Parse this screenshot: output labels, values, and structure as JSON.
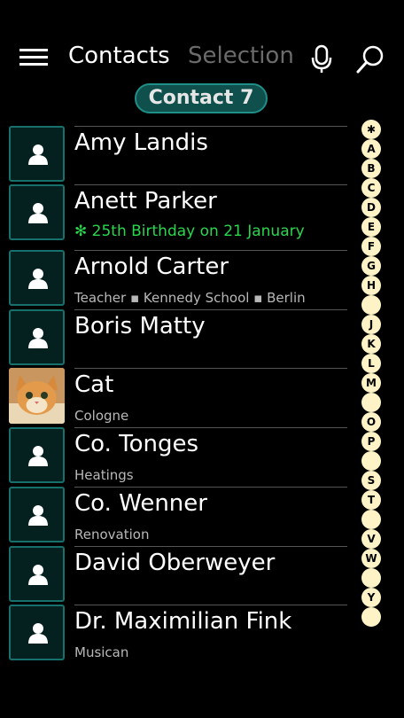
{
  "header": {
    "tab_contacts": "Contacts",
    "tab_selection": "Selection"
  },
  "contact_count": "Contact 7",
  "contacts": [
    {
      "name": "Amy Landis",
      "sub": ""
    },
    {
      "name": "Anett Parker",
      "sub": "✻ 25th Birthday on 21 January"
    },
    {
      "name": "Arnold Carter",
      "sub": "Teacher ▪ Kennedy School ▪ Berlin"
    },
    {
      "name": "Boris Matty",
      "sub": ""
    },
    {
      "name": "Cat",
      "sub": "Cologne"
    },
    {
      "name": "Co. Tonges",
      "sub": "Heatings"
    },
    {
      "name": "Co. Wenner",
      "sub": "Renovation"
    },
    {
      "name": "David Oberweyer",
      "sub": ""
    },
    {
      "name": "Dr. Maximilian Fink",
      "sub": "Musican"
    }
  ],
  "alphabet": [
    "✱",
    "A",
    "B",
    "C",
    "D",
    "E",
    "F",
    "G",
    "H",
    "",
    "J",
    "K",
    "L",
    "M",
    "",
    "O",
    "P",
    "",
    "S",
    "T",
    "",
    "V",
    "W",
    "",
    "Y",
    ""
  ],
  "colors": {
    "accent": "#1f8f87",
    "birthday": "#2bd64f",
    "index_bg": "#fdf3c7"
  },
  "icons": [
    "hamburger-icon",
    "microphone-icon",
    "search-icon",
    "person-icon"
  ]
}
